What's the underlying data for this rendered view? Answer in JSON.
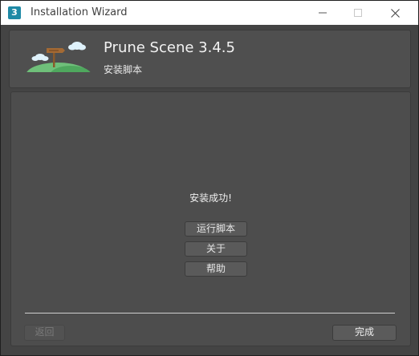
{
  "window": {
    "title": "Installation Wizard",
    "app_icon_glyph": "3",
    "controls": {
      "minimize_icon": "minimize-icon",
      "maximize_icon": "maximize-icon",
      "close_icon": "close-icon"
    }
  },
  "header": {
    "product_name": "Prune Scene 3.4.5",
    "subtitle": "安装脚本",
    "logo_icon": "signpost-hill-icon"
  },
  "content": {
    "success_message": "安装成功!",
    "buttons": {
      "run_script": "运行脚本",
      "about": "关于",
      "help": "帮助"
    }
  },
  "footer": {
    "back_label": "返回",
    "back_enabled": false,
    "finish_label": "完成"
  },
  "colors": {
    "window_bg": "#444444",
    "titlebar_bg": "#ffffff",
    "app_icon_bg": "#1f8aa6",
    "hill_green": "#5fb86a",
    "sign_brown": "#8a5a2b"
  }
}
